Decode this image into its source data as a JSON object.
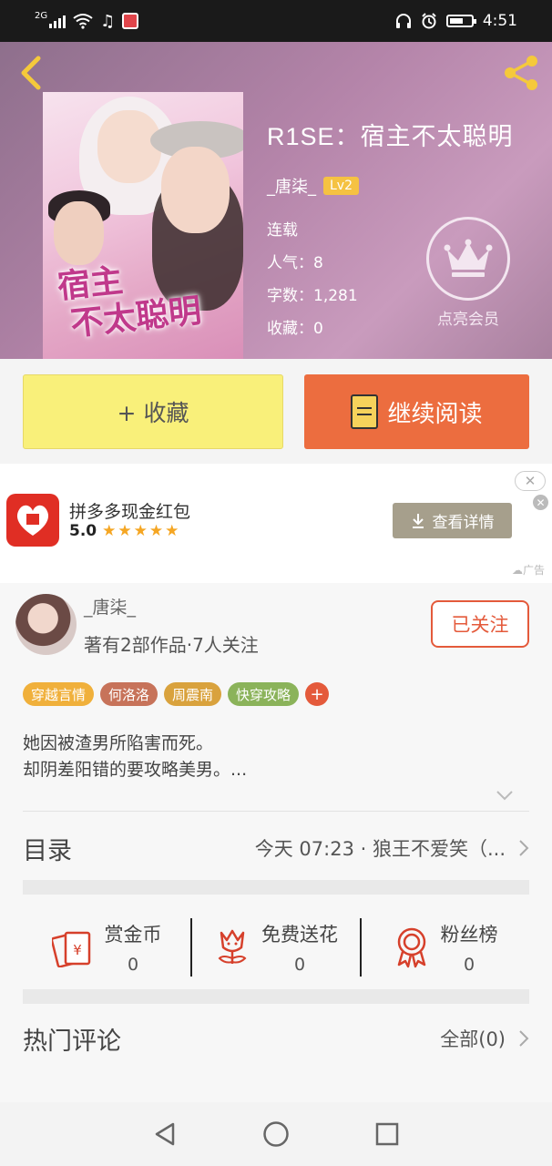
{
  "status_bar": {
    "network": "2G",
    "time": "4:51"
  },
  "book": {
    "title": "R1SE：宿主不太聪明",
    "cover_title_line1": "宿主",
    "cover_title_line2": "不太聪明",
    "author": "_唐柒_",
    "level": "Lv2",
    "status": "连载",
    "popularity": "人气：8",
    "word_count": "字数：1,281",
    "favorites": "收藏：0"
  },
  "vip": {
    "label": "点亮会员"
  },
  "actions": {
    "favorite_label": "+ 收藏",
    "read_label": "继续阅读"
  },
  "ad": {
    "title": "拼多多现金红包",
    "rating": "5.0",
    "stars": "★★★★★",
    "button_label": "查看详情",
    "tag": "广告",
    "close_pill": "✕"
  },
  "author_section": {
    "name": "_唐柒_",
    "summary": "著有2部作品·7人关注",
    "follow_label": "已关注"
  },
  "tags": [
    {
      "label": "穿越言情",
      "color": "#f0b03b"
    },
    {
      "label": "何洛洛",
      "color": "#c7735a"
    },
    {
      "label": "周震南",
      "color": "#d9a23d"
    },
    {
      "label": "快穿攻略",
      "color": "#8bb35a"
    }
  ],
  "intro": {
    "line1": "她因被渣男所陷害而死。",
    "line2": "却阴差阳错的要攻略美男。..."
  },
  "toc": {
    "label": "目录",
    "latest": "今天 07:23 · 狼王不爱笑（..."
  },
  "rewards": [
    {
      "label": "赏金币",
      "count": "0",
      "icon": "red-envelope-icon"
    },
    {
      "label": "免费送花",
      "count": "0",
      "icon": "flower-icon"
    },
    {
      "label": "粉丝榜",
      "count": "0",
      "icon": "medal-icon"
    }
  ],
  "comments": {
    "label": "热门评论",
    "all_label": "全部(0)"
  },
  "colors": {
    "accent": "#e45a3b",
    "read_button": "#ec6d3f",
    "favorite_button": "#f9f07a",
    "icon_red": "#d6402b"
  }
}
